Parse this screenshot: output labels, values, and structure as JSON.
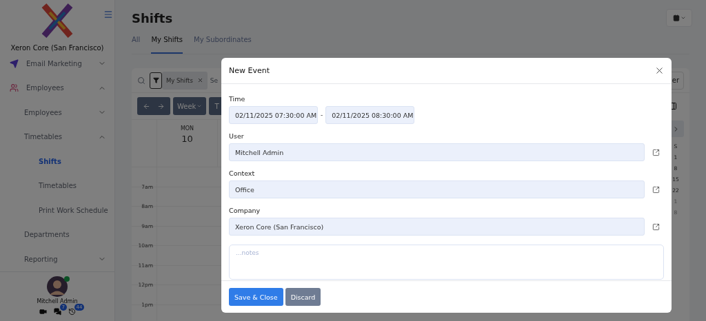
{
  "sidebar": {
    "company": "Xeron Core (San Francisco)",
    "items": [
      {
        "label": "Email Marketing",
        "kind": "send",
        "expanded": false,
        "selected": false
      },
      {
        "label": "Employees",
        "kind": "people",
        "expanded": true,
        "selected": false,
        "children": [
          {
            "label": "Employees",
            "expanded": false,
            "selected": false
          },
          {
            "label": "Timetables",
            "expanded": true,
            "selected": false,
            "children": [
              {
                "label": "Shifts",
                "selected": true
              },
              {
                "label": "Timetables",
                "selected": false
              },
              {
                "label": "Print Work Schedule",
                "selected": false
              }
            ]
          },
          {
            "label": "Departments",
            "selected": false
          },
          {
            "label": "Reporting",
            "expanded": false,
            "selected": false
          }
        ]
      }
    ],
    "user": {
      "name": "Mitchell Admin",
      "online": true
    },
    "shortcuts": [
      {
        "kind": "video"
      },
      {
        "kind": "chat",
        "count": "7"
      },
      {
        "kind": "activity",
        "count": "44"
      }
    ]
  },
  "page": {
    "title": "Shifts",
    "tabs": [
      {
        "label": "All",
        "selected": false
      },
      {
        "label": "My Shifts",
        "selected": true
      },
      {
        "label": "My Subordinates",
        "selected": false
      }
    ],
    "filter": {
      "chip": "My Shifts",
      "search_placeholder": "Se",
      "right_button": "er"
    },
    "toolbar": {
      "view": "Week",
      "today": "T"
    },
    "calendar": {
      "weekday": "MON",
      "date": "10",
      "times": [
        "7am",
        "8am",
        "9am",
        "10am",
        "11am",
        "12pm",
        "1pm"
      ]
    },
    "mini_calendar": {
      "weekday": "S",
      "days": [
        {
          "label": "1",
          "muted": false
        },
        {
          "label": "8",
          "muted": false
        },
        {
          "label": "15",
          "muted": false
        },
        {
          "label": "22",
          "muted": false
        },
        {
          "label": "1",
          "muted": true
        },
        {
          "label": "8",
          "muted": true
        }
      ]
    }
  },
  "modal": {
    "title": "New Event",
    "time": {
      "label": "Time",
      "from": "02/11/2025 07:30:00 AM",
      "separator": "-",
      "to": "02/11/2025 08:30:00 AM"
    },
    "fields": [
      {
        "label": "User",
        "value": "Mitchell Admin"
      },
      {
        "label": "Context",
        "value": "Office"
      },
      {
        "label": "Company",
        "value": "Xeron Core (San Francisco)"
      }
    ],
    "notes": {
      "placeholder": "...notes"
    },
    "buttons": [
      {
        "label": "Save & Close",
        "kind": "primary"
      },
      {
        "label": "Discard",
        "kind": "secondary"
      }
    ]
  }
}
